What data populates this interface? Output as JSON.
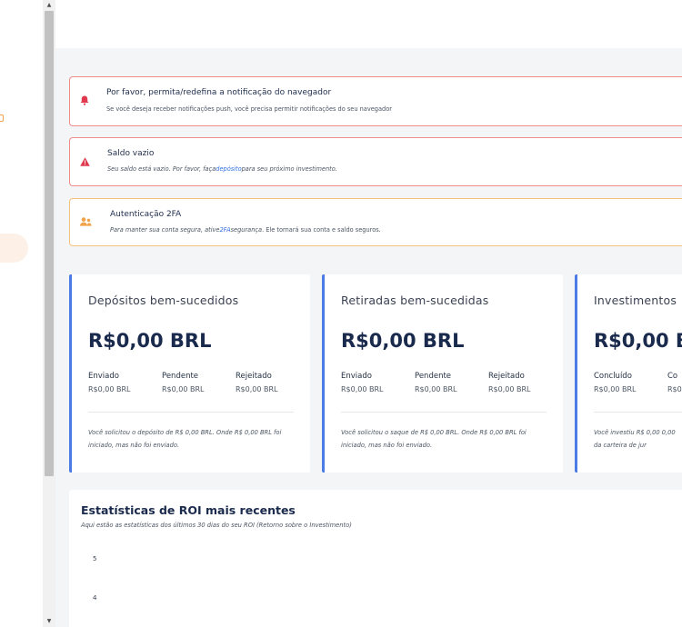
{
  "scrollbar": {
    "up_arrow": "▲",
    "down_arrow": "▼"
  },
  "alerts": {
    "notification": {
      "icon": "bell-icon",
      "glyph": "🔔",
      "title": "Por favor, permita/redefina a notificação do navegador",
      "text": "Se você deseja receber notificações push, você precisa permitir notificações do seu navegador"
    },
    "balance": {
      "icon": "warning-icon",
      "glyph": "▲",
      "title": "Saldo vazio",
      "text_before": "Seu saldo está vazio. Por favor, faça",
      "link": "depósito",
      "text_after": "para seu próximo investimento."
    },
    "twofa": {
      "icon": "user-shield-icon",
      "glyph": "👥",
      "title": "Autenticação 2FA",
      "text_before": "Para manter sua conta segura, ative",
      "link": "2FA",
      "text_middle": "segurança",
      "text_after": ". Ele tornará sua conta e saldo seguros."
    }
  },
  "cards": [
    {
      "title": "Depósitos bem-sucedidos",
      "amount": "R$0,00 BRL",
      "columns": [
        {
          "label": "Enviado",
          "value": "R$0,00 BRL"
        },
        {
          "label": "Pendente",
          "value": "R$0,00 BRL"
        },
        {
          "label": "Rejeitado",
          "value": "R$0,00 BRL"
        }
      ],
      "note": "Você solicitou o depósito de R$ 0,00 BRL. Onde R$ 0,00 BRL foi iniciado, mas não foi enviado."
    },
    {
      "title": "Retiradas bem-sucedidas",
      "amount": "R$0,00 BRL",
      "columns": [
        {
          "label": "Enviado",
          "value": "R$0,00 BRL"
        },
        {
          "label": "Pendente",
          "value": "R$0,00 BRL"
        },
        {
          "label": "Rejeitado",
          "value": "R$0,00 BRL"
        }
      ],
      "note": "Você solicitou o saque de R$ 0,00 BRL. Onde R$ 0,00 BRL foi iniciado, mas não foi enviado."
    },
    {
      "title": "Investimentos",
      "amount": "R$0,00 B",
      "columns": [
        {
          "label": "Concluído",
          "value": "R$0,00 BRL"
        },
        {
          "label": "Co",
          "value": "R$0"
        }
      ],
      "note": "Você investiu R$ 0,00 0,00 da carteira de jur"
    }
  ],
  "stats": {
    "title": "Estatísticas de ROI mais recentes",
    "subtitle": "Aqui estão as estatísticas dos últimos 30 dias do seu ROI (Retorno sobre o Investimento)",
    "y_ticks": [
      "5",
      "4"
    ]
  },
  "colors": {
    "accent": "#4b7be5",
    "danger": "#e0394d",
    "warning": "#f0a34a",
    "heading": "#1a2a4d"
  }
}
